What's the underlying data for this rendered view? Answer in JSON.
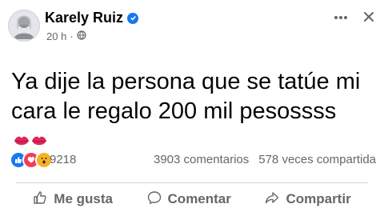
{
  "post": {
    "author": "Karely Ruiz",
    "time": "20 h",
    "separator": "·",
    "text": "Ya dije la persona que se tatúe mi cara le regalo 200 mil pesossss"
  },
  "stats": {
    "reactions_count": "9218",
    "comments": "3903 comentarios",
    "shares": "578 veces compartida"
  },
  "actions": {
    "like": "Me gusta",
    "comment": "Comentar",
    "share": "Compartir"
  },
  "icons": {
    "verified": "verified-badge-icon",
    "privacy": "globe-icon",
    "more": "more-options-icon",
    "close": "close-icon",
    "lips": "kiss-mark-icon",
    "like": "thumbs-up-icon",
    "comment": "speech-bubble-icon",
    "share": "share-arrow-icon"
  },
  "colors": {
    "brand": "#1877f2",
    "text": "#050505",
    "secondary": "#65676b",
    "love": "#f33e58",
    "wow": "#f7b125"
  }
}
